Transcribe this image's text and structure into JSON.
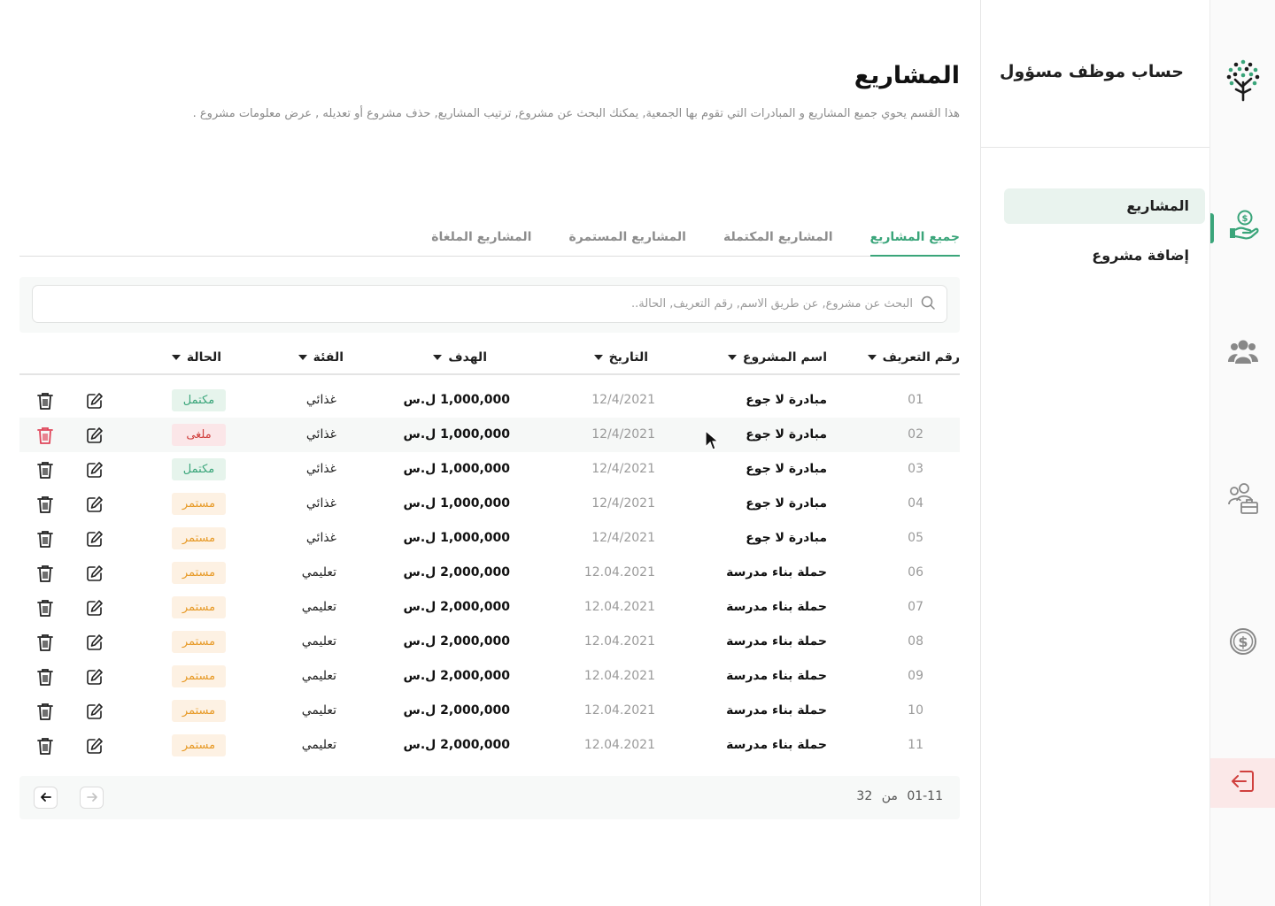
{
  "sidebar": {
    "account_title": "حساب موظف مسؤول",
    "items": [
      {
        "label": "المشاريع",
        "active": true
      },
      {
        "label": "إضافة مشروع",
        "active": false
      }
    ]
  },
  "rail": {
    "logo_icon": "tree-logo-icon",
    "items": [
      "hand-coin-icon",
      "group-icon",
      "staff-icon",
      "dollar-icon"
    ],
    "logout_icon": "logout-icon"
  },
  "page": {
    "title": "المشاريع",
    "description": "هذا القسم يحوي جميع المشاريع و المبادرات التي تقوم بها الجمعية, يمكنك البحث عن مشروع, ترتيب المشاريع,  حذف مشروع أو تعديله , عرض معلومات مشروع ."
  },
  "tabs": [
    {
      "label": "جميع المشاريع",
      "active": true
    },
    {
      "label": "المشاريع المكتملة",
      "active": false
    },
    {
      "label": "المشاريع المستمرة",
      "active": false
    },
    {
      "label": "المشاريع الملغاة",
      "active": false
    }
  ],
  "search": {
    "placeholder": "البحث عن مشروع, عن طريق الاسم, رقم التعريف, الحالة..",
    "value": ""
  },
  "table": {
    "headers": {
      "id": "رقم التعريف",
      "name": "اسم المشروع",
      "date": "التاريخ",
      "goal": "الهدف",
      "category": "الفئة",
      "status": "الحالة"
    },
    "rows": [
      {
        "id": "01",
        "name": "مبادرة لا جوع",
        "date": "12/4/2021",
        "goal": "1,000,000 ل.س",
        "category": "غذائي",
        "status": "مكتمل",
        "status_type": "green"
      },
      {
        "id": "02",
        "name": "مبادرة لا جوع",
        "date": "12/4/2021",
        "goal": "1,000,000 ل.س",
        "category": "غذائي",
        "status": "ملغى",
        "status_type": "red"
      },
      {
        "id": "03",
        "name": "مبادرة لا جوع",
        "date": "12/4/2021",
        "goal": "1,000,000 ل.س",
        "category": "غذائي",
        "status": "مكتمل",
        "status_type": "green"
      },
      {
        "id": "04",
        "name": "مبادرة لا جوع",
        "date": "12/4/2021",
        "goal": "1,000,000 ل.س",
        "category": "غذائي",
        "status": "مستمر",
        "status_type": "orange"
      },
      {
        "id": "05",
        "name": "مبادرة لا جوع",
        "date": "12/4/2021",
        "goal": "1,000,000 ل.س",
        "category": "غذائي",
        "status": "مستمر",
        "status_type": "orange"
      },
      {
        "id": "06",
        "name": "حملة بناء مدرسة",
        "date": "12.04.2021",
        "goal": "2,000,000 ل.س",
        "category": "تعليمي",
        "status": "مستمر",
        "status_type": "orange"
      },
      {
        "id": "07",
        "name": "حملة بناء مدرسة",
        "date": "12.04.2021",
        "goal": "2,000,000 ل.س",
        "category": "تعليمي",
        "status": "مستمر",
        "status_type": "orange"
      },
      {
        "id": "08",
        "name": "حملة بناء مدرسة",
        "date": "12.04.2021",
        "goal": "2,000,000 ل.س",
        "category": "تعليمي",
        "status": "مستمر",
        "status_type": "orange"
      },
      {
        "id": "09",
        "name": "حملة بناء مدرسة",
        "date": "12.04.2021",
        "goal": "2,000,000 ل.س",
        "category": "تعليمي",
        "status": "مستمر",
        "status_type": "orange"
      },
      {
        "id": "10",
        "name": "حملة بناء مدرسة",
        "date": "12.04.2021",
        "goal": "2,000,000 ل.س",
        "category": "تعليمي",
        "status": "مستمر",
        "status_type": "orange"
      },
      {
        "id": "11",
        "name": "حملة بناء مدرسة",
        "date": "12.04.2021",
        "goal": "2,000,000 ل.س",
        "category": "تعليمي",
        "status": "مستمر",
        "status_type": "orange"
      }
    ]
  },
  "pagination": {
    "range": "01-11",
    "of_label": "من",
    "total": "32"
  },
  "colors": {
    "accent": "#3aa57a",
    "danger": "#d0403e",
    "warning": "#e79a27"
  }
}
